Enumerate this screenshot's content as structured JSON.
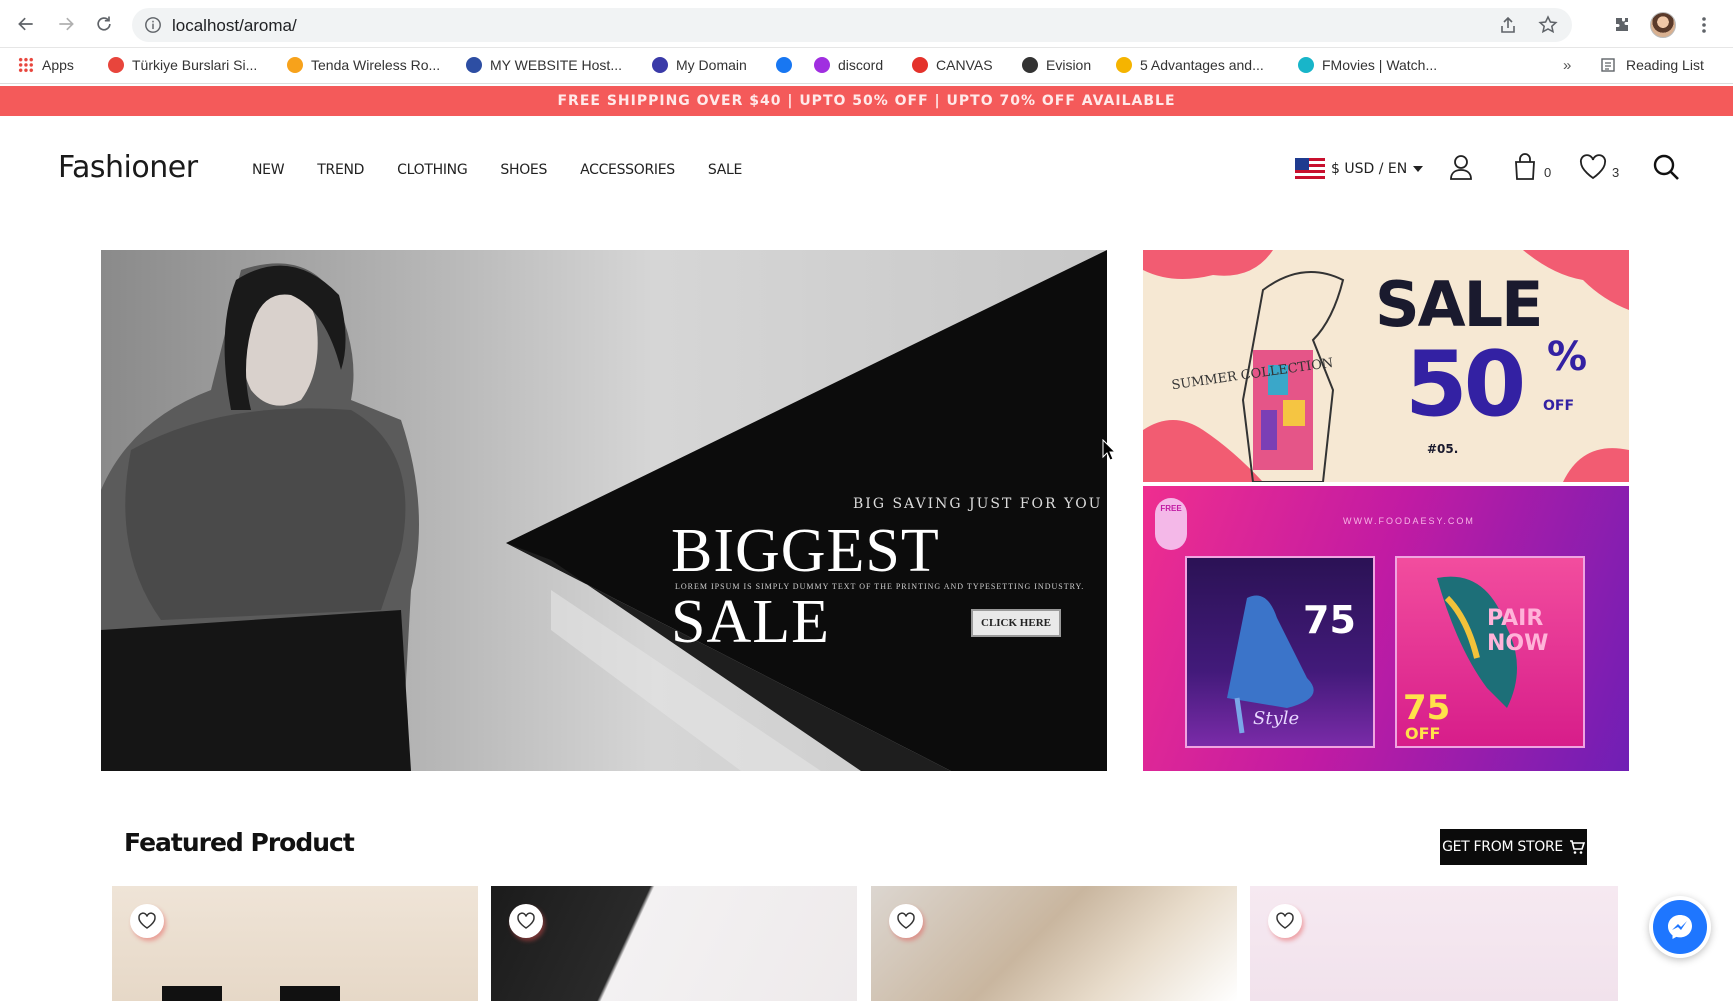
{
  "browser": {
    "url": "localhost/aroma/",
    "bookmarks": [
      {
        "label": "Apps",
        "icon": "apps-grid-icon",
        "color": "#e8453c"
      },
      {
        "label": "Türkiye Burslari Si...",
        "icon": "bookmark-icon",
        "color": "#e8453c"
      },
      {
        "label": "Tenda Wireless Ro...",
        "icon": "tenda-icon",
        "color": "#f7a21b"
      },
      {
        "label": "MY WEBSITE Host...",
        "icon": "host-icon",
        "color": "#2d4ea3"
      },
      {
        "label": "My Domain",
        "icon": "domain-icon",
        "color": "#3a3aa8"
      },
      {
        "label": "",
        "icon": "facebook-icon",
        "color": "#1877f2"
      },
      {
        "label": "discord",
        "icon": "discord-icon",
        "color": "#a02ee0"
      },
      {
        "label": "CANVAS",
        "icon": "canvas-icon",
        "color": "#e4322b"
      },
      {
        "label": "Evision",
        "icon": "evision-icon",
        "color": "#333333"
      },
      {
        "label": "5 Advantages and...",
        "icon": "smiley-icon",
        "color": "#f5b400"
      },
      {
        "label": "FMovies | Watch...",
        "icon": "fmovies-icon",
        "color": "#18b5c9"
      }
    ],
    "more": "»",
    "reading_list": "Reading List"
  },
  "announcement": "FREE SHIPPING OVER $40 |   UPTO 50% OFF |   UPTO 70% OFF AVAILABLE",
  "header": {
    "logo": "Fashioner",
    "nav": [
      "NEW",
      "TREND",
      "CLOTHING",
      "SHOES",
      "ACCESSORIES",
      "SALE"
    ],
    "currency": "$ USD / EN",
    "cart_count": "0",
    "wishlist_count": "3"
  },
  "hero": {
    "kicker": "BIG SAVING JUST FOR YOU",
    "headline": "BIGGEST SALE",
    "sub": "LOREM IPSUM IS SIMPLY DUMMY TEXT OF THE PRINTING AND TYPESETTING INDUSTRY.",
    "cta": "CLICK HERE"
  },
  "promo1": {
    "sale": "SALE",
    "percent": "50",
    "percent_sign": "%",
    "off": "OFF",
    "tag": "#05.",
    "collection": "SUMMER COLLECTION"
  },
  "promo2": {
    "site": "WWW.FOODAESY.COM",
    "badge": "FREE",
    "card1_percent": "75",
    "card1_style": "Style",
    "card2_percent": "75",
    "card2_off": "OFF",
    "card2_text": "PAIR NOW"
  },
  "featured": {
    "title": "Featured Product",
    "store_button": "GET FROM STORE"
  },
  "colors": {
    "announce_bg": "#f45a5a",
    "promo_purple": "#3321a3",
    "messenger_blue": "#1e76ff"
  }
}
